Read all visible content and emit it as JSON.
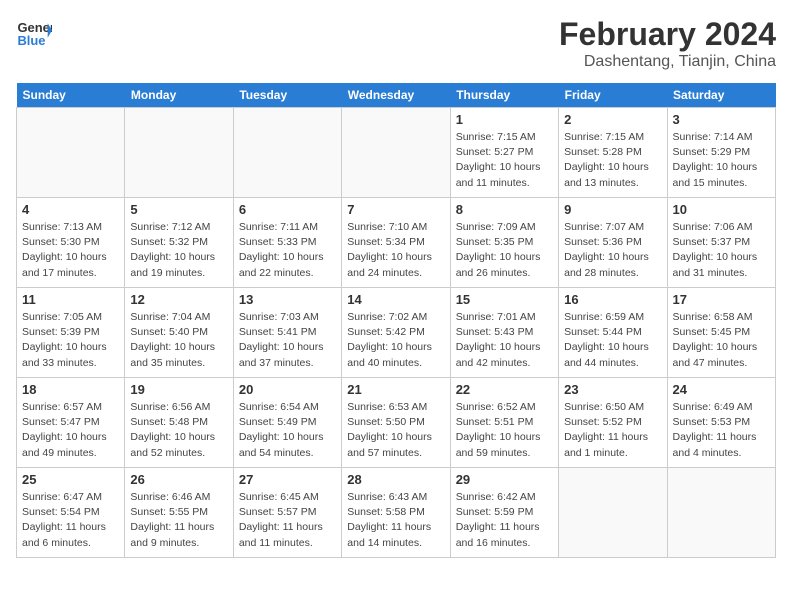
{
  "header": {
    "logo_line1": "General",
    "logo_line2": "Blue",
    "month_year": "February 2024",
    "location": "Dashentang, Tianjin, China"
  },
  "days_of_week": [
    "Sunday",
    "Monday",
    "Tuesday",
    "Wednesday",
    "Thursday",
    "Friday",
    "Saturday"
  ],
  "weeks": [
    [
      {
        "day": "",
        "empty": true
      },
      {
        "day": "",
        "empty": true
      },
      {
        "day": "",
        "empty": true
      },
      {
        "day": "",
        "empty": true
      },
      {
        "day": "1",
        "sunrise": "7:15 AM",
        "sunset": "5:27 PM",
        "daylight": "10 hours and 11 minutes."
      },
      {
        "day": "2",
        "sunrise": "7:15 AM",
        "sunset": "5:28 PM",
        "daylight": "10 hours and 13 minutes."
      },
      {
        "day": "3",
        "sunrise": "7:14 AM",
        "sunset": "5:29 PM",
        "daylight": "10 hours and 15 minutes."
      }
    ],
    [
      {
        "day": "4",
        "sunrise": "7:13 AM",
        "sunset": "5:30 PM",
        "daylight": "10 hours and 17 minutes."
      },
      {
        "day": "5",
        "sunrise": "7:12 AM",
        "sunset": "5:32 PM",
        "daylight": "10 hours and 19 minutes."
      },
      {
        "day": "6",
        "sunrise": "7:11 AM",
        "sunset": "5:33 PM",
        "daylight": "10 hours and 22 minutes."
      },
      {
        "day": "7",
        "sunrise": "7:10 AM",
        "sunset": "5:34 PM",
        "daylight": "10 hours and 24 minutes."
      },
      {
        "day": "8",
        "sunrise": "7:09 AM",
        "sunset": "5:35 PM",
        "daylight": "10 hours and 26 minutes."
      },
      {
        "day": "9",
        "sunrise": "7:07 AM",
        "sunset": "5:36 PM",
        "daylight": "10 hours and 28 minutes."
      },
      {
        "day": "10",
        "sunrise": "7:06 AM",
        "sunset": "5:37 PM",
        "daylight": "10 hours and 31 minutes."
      }
    ],
    [
      {
        "day": "11",
        "sunrise": "7:05 AM",
        "sunset": "5:39 PM",
        "daylight": "10 hours and 33 minutes."
      },
      {
        "day": "12",
        "sunrise": "7:04 AM",
        "sunset": "5:40 PM",
        "daylight": "10 hours and 35 minutes."
      },
      {
        "day": "13",
        "sunrise": "7:03 AM",
        "sunset": "5:41 PM",
        "daylight": "10 hours and 37 minutes."
      },
      {
        "day": "14",
        "sunrise": "7:02 AM",
        "sunset": "5:42 PM",
        "daylight": "10 hours and 40 minutes."
      },
      {
        "day": "15",
        "sunrise": "7:01 AM",
        "sunset": "5:43 PM",
        "daylight": "10 hours and 42 minutes."
      },
      {
        "day": "16",
        "sunrise": "6:59 AM",
        "sunset": "5:44 PM",
        "daylight": "10 hours and 44 minutes."
      },
      {
        "day": "17",
        "sunrise": "6:58 AM",
        "sunset": "5:45 PM",
        "daylight": "10 hours and 47 minutes."
      }
    ],
    [
      {
        "day": "18",
        "sunrise": "6:57 AM",
        "sunset": "5:47 PM",
        "daylight": "10 hours and 49 minutes."
      },
      {
        "day": "19",
        "sunrise": "6:56 AM",
        "sunset": "5:48 PM",
        "daylight": "10 hours and 52 minutes."
      },
      {
        "day": "20",
        "sunrise": "6:54 AM",
        "sunset": "5:49 PM",
        "daylight": "10 hours and 54 minutes."
      },
      {
        "day": "21",
        "sunrise": "6:53 AM",
        "sunset": "5:50 PM",
        "daylight": "10 hours and 57 minutes."
      },
      {
        "day": "22",
        "sunrise": "6:52 AM",
        "sunset": "5:51 PM",
        "daylight": "10 hours and 59 minutes."
      },
      {
        "day": "23",
        "sunrise": "6:50 AM",
        "sunset": "5:52 PM",
        "daylight": "11 hours and 1 minute."
      },
      {
        "day": "24",
        "sunrise": "6:49 AM",
        "sunset": "5:53 PM",
        "daylight": "11 hours and 4 minutes."
      }
    ],
    [
      {
        "day": "25",
        "sunrise": "6:47 AM",
        "sunset": "5:54 PM",
        "daylight": "11 hours and 6 minutes."
      },
      {
        "day": "26",
        "sunrise": "6:46 AM",
        "sunset": "5:55 PM",
        "daylight": "11 hours and 9 minutes."
      },
      {
        "day": "27",
        "sunrise": "6:45 AM",
        "sunset": "5:57 PM",
        "daylight": "11 hours and 11 minutes."
      },
      {
        "day": "28",
        "sunrise": "6:43 AM",
        "sunset": "5:58 PM",
        "daylight": "11 hours and 14 minutes."
      },
      {
        "day": "29",
        "sunrise": "6:42 AM",
        "sunset": "5:59 PM",
        "daylight": "11 hours and 16 minutes."
      },
      {
        "day": "",
        "empty": true
      },
      {
        "day": "",
        "empty": true
      }
    ]
  ],
  "labels": {
    "sunrise": "Sunrise:",
    "sunset": "Sunset:",
    "daylight": "Daylight:"
  }
}
